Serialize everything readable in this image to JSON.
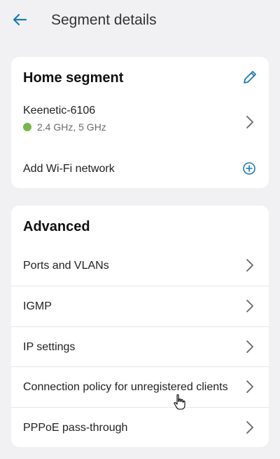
{
  "header": {
    "title": "Segment details",
    "back_icon": "arrow-left-icon",
    "accent": "#1a7ab8"
  },
  "home_segment": {
    "title": "Home segment",
    "edit_icon": "pencil-icon",
    "network": {
      "name": "Keenetic-6106",
      "status_color": "#7ab648",
      "bands": "2.4 GHz, 5 GHz"
    },
    "add_wifi_label": "Add Wi-Fi network",
    "add_icon": "plus-circle-icon"
  },
  "advanced": {
    "title": "Advanced",
    "items": [
      {
        "label": "Ports and VLANs"
      },
      {
        "label": "IGMP"
      },
      {
        "label": "IP settings"
      },
      {
        "label": "Connection policy for unregistered clients"
      },
      {
        "label": "PPPoE pass-through"
      }
    ]
  }
}
